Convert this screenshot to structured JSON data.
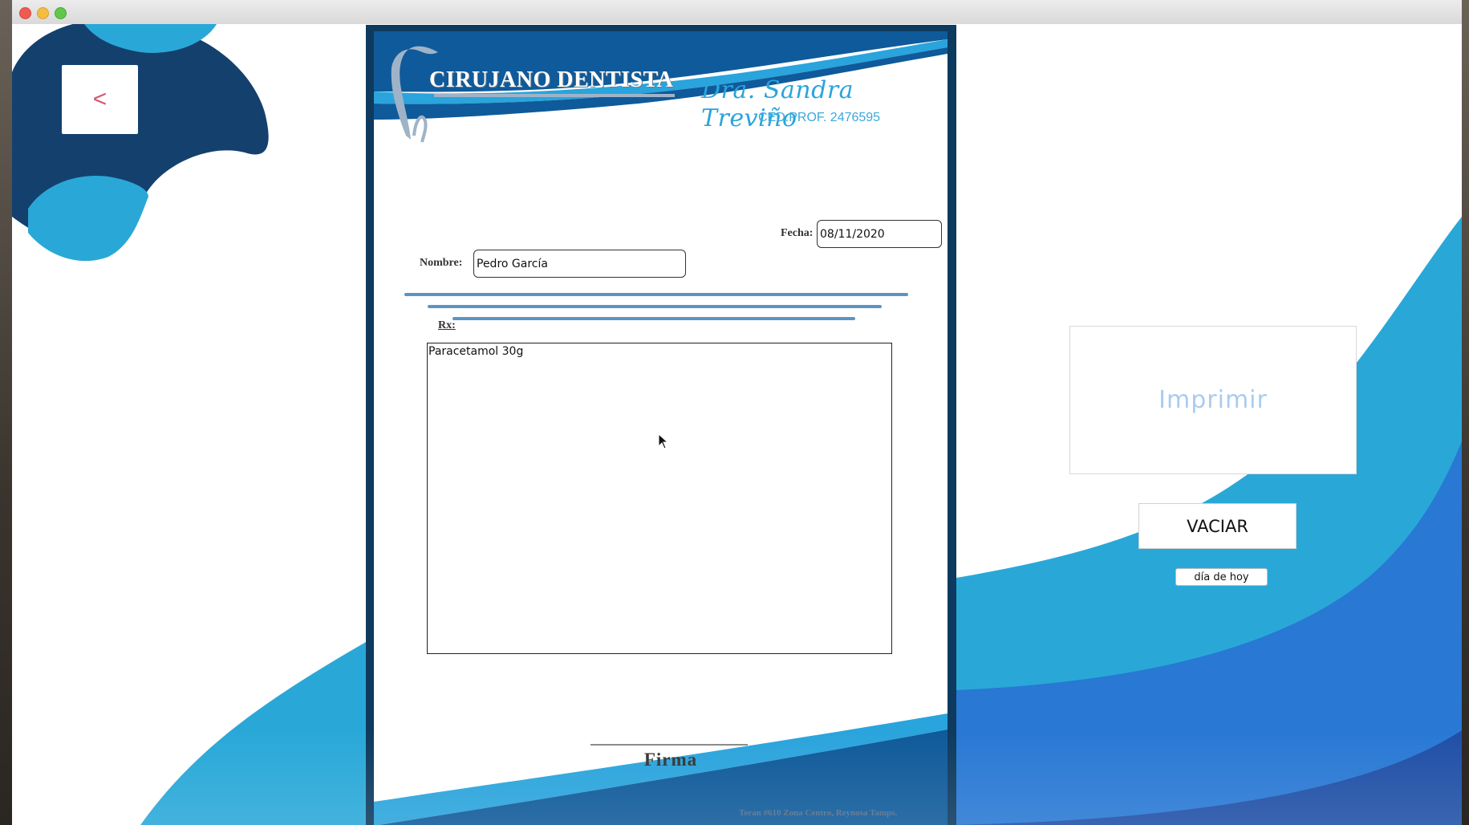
{
  "window": {
    "controls": [
      "close",
      "minimize",
      "maximize"
    ]
  },
  "back_button": {
    "label": "<"
  },
  "sheet": {
    "brand_title": "CIRUJANO DENTISTA",
    "doctor_name": "Dra. Sandra Treviño",
    "cedula": "CED.PROF. 2476595",
    "fecha_label": "Fecha:",
    "fecha_value": "08/11/2020",
    "nombre_label": "Nombre:",
    "nombre_value": "Pedro García",
    "rx_label": "Rx:",
    "rx_value": "Paracetamol 30g ",
    "firma_label": "Firma",
    "address": "Teran #610 Zona Centro, Reynosa Tamps."
  },
  "actions": {
    "print_label": "Imprimir",
    "empty_label": "VACIAR",
    "today_label": "día de hoy"
  },
  "colors": {
    "navy": "#0d3a5e",
    "dark_blue": "#14406e",
    "light_blue": "#2aa4dc",
    "mid_blue": "#2878d4",
    "back_arrow": "#d9546e",
    "print_text": "#a9ccee"
  }
}
